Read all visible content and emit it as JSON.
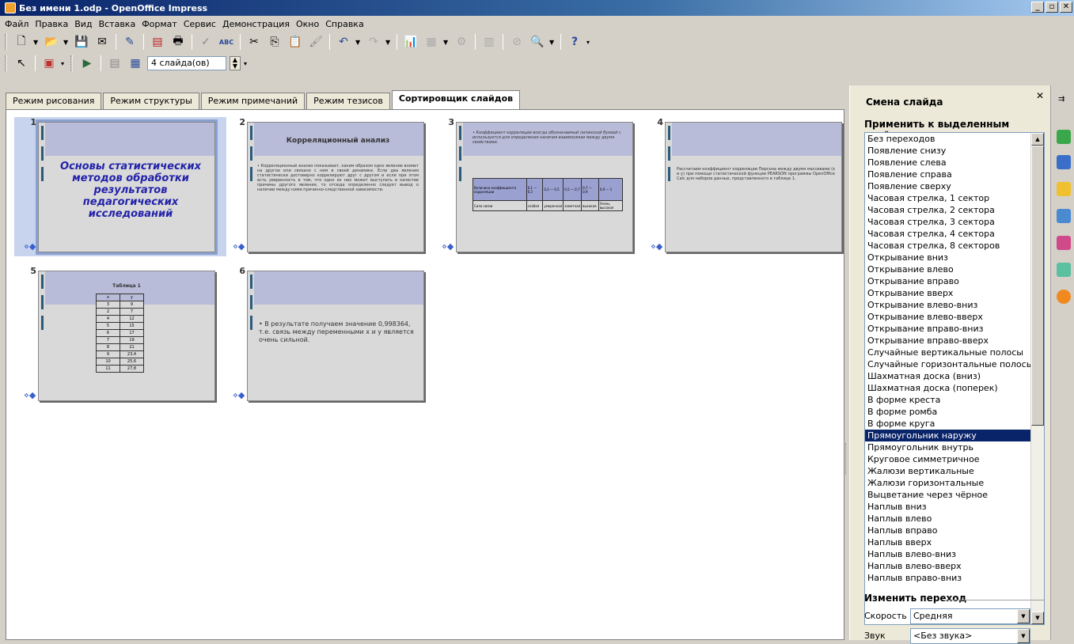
{
  "window": {
    "title": "Без имени 1.odp - OpenOffice Impress"
  },
  "menu": [
    "Файл",
    "Правка",
    "Вид",
    "Вставка",
    "Формат",
    "Сервис",
    "Демонстрация",
    "Окно",
    "Справка"
  ],
  "toolbar2": {
    "slides_count": "4 слайда(ов)"
  },
  "tabs": [
    "Режим рисования",
    "Режим структуры",
    "Режим примечаний",
    "Режим тезисов",
    "Сортировщик слайдов"
  ],
  "slides": [
    {
      "num": "1",
      "title": "Основы статистических методов обработки результатов педагогических исследований"
    },
    {
      "num": "2",
      "header": "Корреляционный анализ",
      "body": "• Корреляционный анализ показывает, каким образом одно явление влияет на другое или связано с ним в своей динамике. Если два явления статистически достоверно коррелируют друг с другом и если при этом есть уверенность в том, что одно из них может выступать в качестве причины другого явления, то отсюда определенно следует вывод о наличии между ними причинно-следственной зависимости."
    },
    {
      "num": "3",
      "header": "• Коэффициент корреляции всегда обозначаемый латинской буквой r, используется для определения наличия взаимосвязи между двумя свойствами.",
      "table": {
        "head": [
          "Величина коэффициента корреляции",
          "0,1 — 0,3",
          "0,3 — 0,5",
          "0,5 — 0,7",
          "0,7 — 0,9",
          "0,9 — 1"
        ],
        "row": [
          "Сила связи",
          "слабая",
          "умеренная",
          "заметная",
          "высокая",
          "Очень высокая"
        ]
      }
    },
    {
      "num": "4",
      "body": "Рассчитаем коэффициент корреляции Пирсона между двумя массивами (x и y) при помощи статистической функции PEARSON программы OpenOffice Calc для наборов данных, представленного в таблице 1."
    },
    {
      "num": "5",
      "header": "Таблица 1",
      "xy": [
        [
          "x",
          "y"
        ],
        [
          "3",
          "9"
        ],
        [
          "2",
          "7"
        ],
        [
          "4",
          "12"
        ],
        [
          "5",
          "15"
        ],
        [
          "6",
          "17"
        ],
        [
          "7",
          "19"
        ],
        [
          "8",
          "21"
        ],
        [
          "9",
          "23,4"
        ],
        [
          "10",
          "25,6"
        ],
        [
          "11",
          "27,8"
        ]
      ]
    },
    {
      "num": "6",
      "body": "• В результате получаем значение 0,998364, т.е. связь между переменными x и y является очень сильной."
    }
  ],
  "pane": {
    "title": "Смена слайда",
    "apply_section": "Применить к выделенным слайдам",
    "transitions": [
      "Без переходов",
      "Появление снизу",
      "Появление слева",
      "Появление справа",
      "Появление сверху",
      "Часовая стрелка, 1 сектор",
      "Часовая стрелка, 2 сектора",
      "Часовая стрелка, 3 сектора",
      "Часовая стрелка, 4 сектора",
      "Часовая стрелка, 8 секторов",
      "Открывание вниз",
      "Открывание влево",
      "Открывание вправо",
      "Открывание вверх",
      "Открывание влево-вниз",
      "Открывание влево-вверх",
      "Открывание вправо-вниз",
      "Открывание вправо-вверх",
      "Случайные вертикальные полосы",
      "Случайные горизонтальные полосы",
      "Шахматная доска (вниз)",
      "Шахматная доска (поперек)",
      "В форме креста",
      "В форме ромба",
      "В форме круга",
      "Прямоугольник наружу",
      "Прямоугольник внутрь",
      "Круговое симметричное",
      "Жалюзи вертикальные",
      "Жалюзи горизонтальные",
      "Выцветание через чёрное",
      "Наплыв вниз",
      "Наплыв влево",
      "Наплыв вправо",
      "Наплыв вверх",
      "Наплыв влево-вниз",
      "Наплыв влево-вверх",
      "Наплыв вправо-вниз"
    ],
    "selected_transition": "Прямоугольник наружу",
    "modify_section": "Изменить переход",
    "speed_label": "Скорость",
    "speed_value": "Средняя",
    "sound_label": "Звук",
    "sound_value": "<Без звука>"
  },
  "colors": {
    "selection": "#0a246a",
    "slide_band": "#b8bcd8",
    "title_text": "#2222aa"
  }
}
